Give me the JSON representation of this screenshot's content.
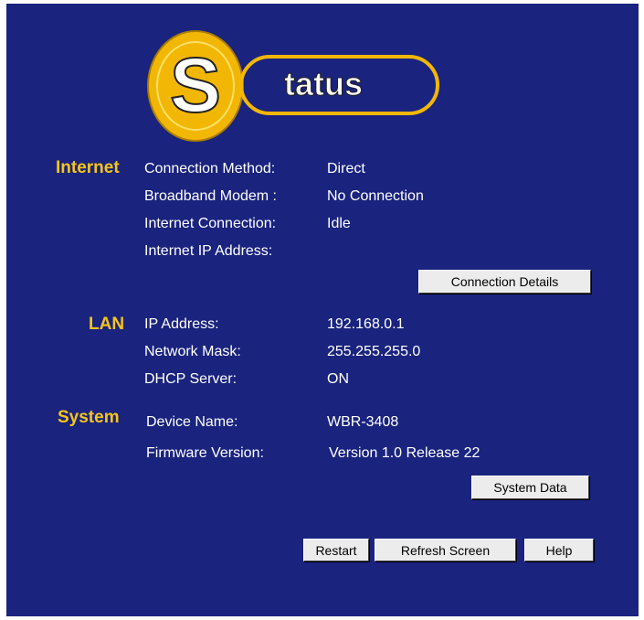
{
  "logo": {
    "letter": "S",
    "text": "tatus"
  },
  "colors": {
    "background": "#1a237e",
    "section_heading": "#f5c518",
    "text": "#ffffff",
    "button": "#ececec"
  },
  "internet": {
    "heading": "Internet",
    "rows": [
      {
        "label": "Connection Method:",
        "value": "Direct"
      },
      {
        "label": "Broadband Modem :",
        "value": "No Connection"
      },
      {
        "label": "Internet Connection:",
        "value": "Idle"
      },
      {
        "label": "Internet IP Address:",
        "value": ""
      }
    ],
    "details_button": "Connection Details"
  },
  "lan": {
    "heading": "LAN",
    "rows": [
      {
        "label": "IP Address:",
        "value": "192.168.0.1"
      },
      {
        "label": "Network Mask:",
        "value": "255.255.255.0"
      },
      {
        "label": "DHCP Server:",
        "value": "ON"
      }
    ]
  },
  "system": {
    "heading": "System",
    "rows": [
      {
        "label": "Device Name:",
        "value": "WBR-3408"
      },
      {
        "label": "Firmware Version:",
        "value": "Version 1.0 Release 22"
      }
    ],
    "data_button": "System Data"
  },
  "footer": {
    "restart": "Restart",
    "refresh": "Refresh Screen",
    "help": "Help"
  }
}
